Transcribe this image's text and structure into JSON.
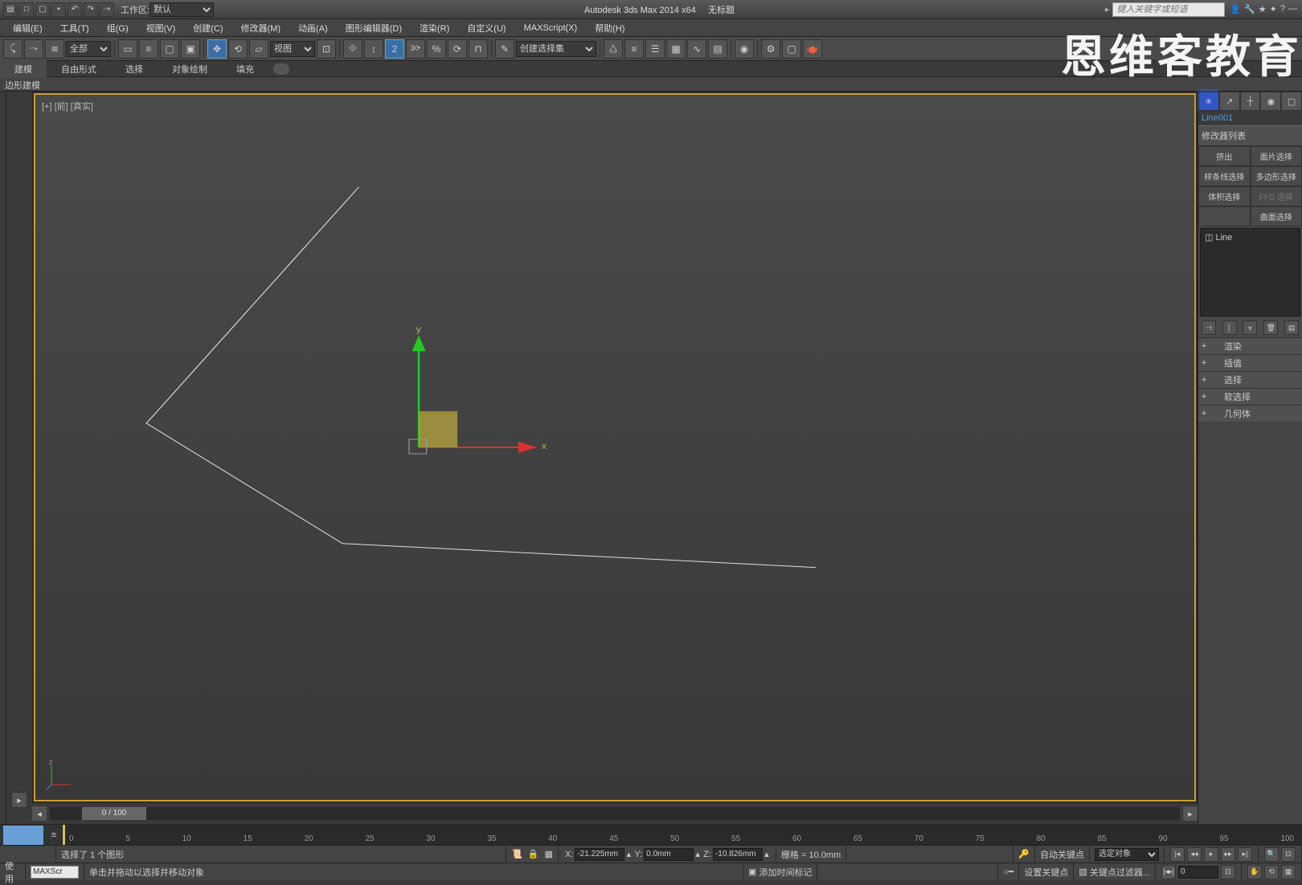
{
  "titleBar": {
    "appTitle": "Autodesk 3ds Max  2014 x64",
    "docTitle": "无标题",
    "workspaceLabel": "工作区:",
    "workspace": "默认",
    "searchPlaceholder": "键入关键字或短语"
  },
  "watermark": "恩维客教育",
  "menu": {
    "edit": "编辑(E)",
    "tools": "工具(T)",
    "group": "组(G)",
    "views": "视图(V)",
    "create": "创建(C)",
    "modifiers": "修改器(M)",
    "animation": "动画(A)",
    "graph": "图形编辑器(D)",
    "rendering": "渲染(R)",
    "customize": "自定义(U)",
    "maxscript": "MAXScript(X)",
    "help": "帮助(H)"
  },
  "toolbar": {
    "filterAll": "全部",
    "viewMode": "视图",
    "createSelSet": "创建选择集"
  },
  "ribbon": {
    "modeling": "建模",
    "freeform": "自由形式",
    "selection": "选择",
    "objectPaint": "对象绘制",
    "populate": "填充"
  },
  "subHeader": "边形建模",
  "viewport": {
    "label": "[+] [前] [真实]",
    "xAxis": "x",
    "yAxis": "y",
    "zAxis": "z"
  },
  "timeSlider": {
    "value": "0 / 100"
  },
  "ruler": {
    "ticks": [
      "0",
      "5",
      "10",
      "15",
      "20",
      "25",
      "30",
      "35",
      "40",
      "45",
      "50",
      "55",
      "60",
      "65",
      "70",
      "75",
      "80",
      "85",
      "90",
      "95",
      "100"
    ]
  },
  "status": {
    "selected": "选择了 1 个图形",
    "prompt": "单击并拖动以选择并移动对象",
    "x": "-21.225mm",
    "y": "0.0mm",
    "z": "-10.826mm",
    "xLabel": "X:",
    "yLabel": "Y:",
    "zLabel": "Z:",
    "grid": "栅格 = 10.0mm",
    "autoKey": "自动关键点",
    "selObj": "选定对象",
    "setKey": "设置关键点",
    "keyFilters": "关键点过滤器...",
    "addTimeTag": "添加时间标记",
    "frame": "0",
    "useLabel": "使用",
    "maxscriptLabel": "MAXScr"
  },
  "commandPanel": {
    "objName": "Line001",
    "modListLabel": "修改器列表",
    "btns": {
      "extrude": "挤出",
      "patchSel": "面片选择",
      "splineSel": "样条线选择",
      "polySel": "多边形选择",
      "volSel": "体积选择",
      "ffdSel": "FFD 选择",
      "surfSel": "曲面选择"
    },
    "stackItem": "Line",
    "rollouts": {
      "rendering": "渲染",
      "interpolation": "插值",
      "selection": "选择",
      "softSel": "软选择",
      "geometry": "几何体"
    }
  }
}
